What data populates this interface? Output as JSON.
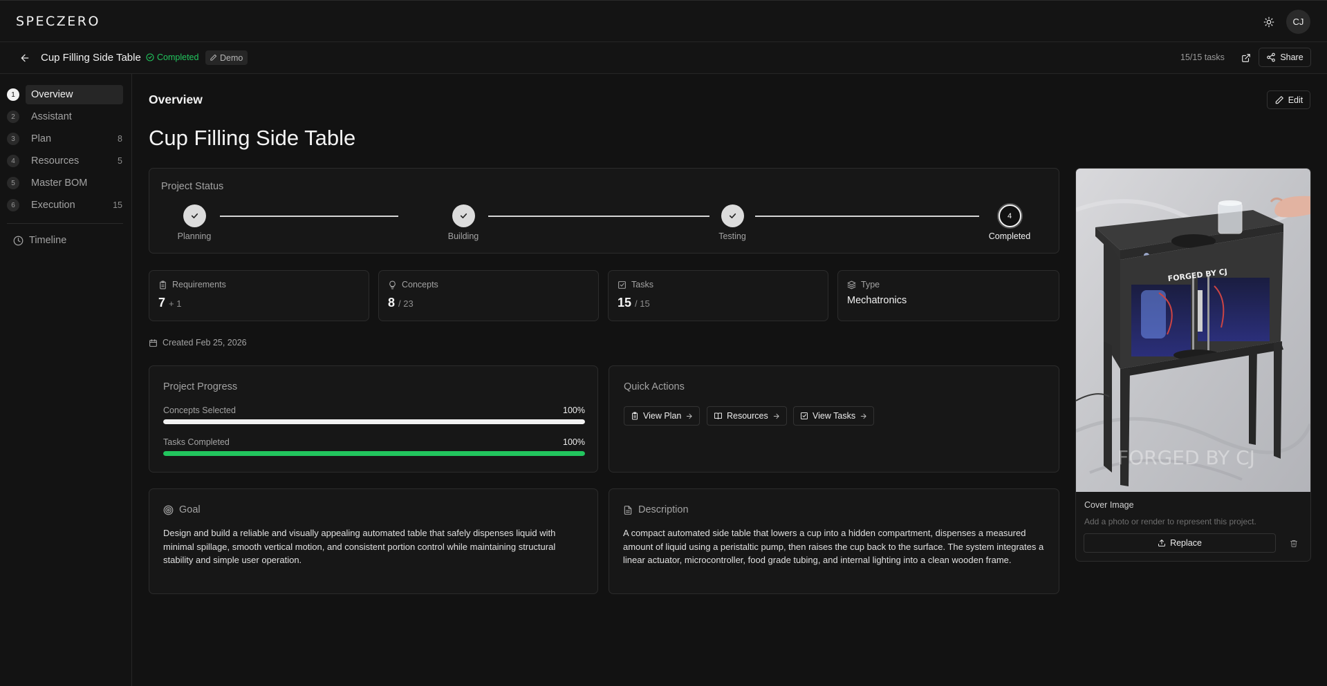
{
  "app": {
    "logo": "SPECZERO",
    "avatar_initials": "CJ"
  },
  "header": {
    "project_name": "Cup Filling Side Table",
    "status": "Completed",
    "badge": "Demo",
    "tasks_count": "15/15 tasks",
    "share_label": "Share"
  },
  "sidebar": {
    "items": [
      {
        "num": "1",
        "label": "Overview",
        "count": ""
      },
      {
        "num": "2",
        "label": "Assistant",
        "count": ""
      },
      {
        "num": "3",
        "label": "Plan",
        "count": "8"
      },
      {
        "num": "4",
        "label": "Resources",
        "count": "5"
      },
      {
        "num": "5",
        "label": "Master BOM",
        "count": ""
      },
      {
        "num": "6",
        "label": "Execution",
        "count": "15"
      }
    ],
    "timeline_label": "Timeline"
  },
  "main": {
    "section_title": "Overview",
    "edit_label": "Edit",
    "title": "Cup Filling Side Table",
    "project_status": {
      "label": "Project Status",
      "steps": [
        {
          "label": "Planning",
          "state": "done"
        },
        {
          "label": "Building",
          "state": "done"
        },
        {
          "label": "Testing",
          "state": "done"
        },
        {
          "label": "Completed",
          "state": "current",
          "num": "4"
        }
      ]
    },
    "stats": {
      "requirements": {
        "label": "Requirements",
        "value": "7",
        "sub": "+ 1"
      },
      "concepts": {
        "label": "Concepts",
        "value": "8",
        "sub": "/ 23"
      },
      "tasks": {
        "label": "Tasks",
        "value": "15",
        "sub": "/ 15"
      },
      "type": {
        "label": "Type",
        "value": "Mechatronics"
      }
    },
    "created": "Created Feb 25, 2026",
    "progress": {
      "label": "Project Progress",
      "rows": [
        {
          "label": "Concepts Selected",
          "pct": "100%",
          "fraction": 1.0,
          "color": "#f2f2f2"
        },
        {
          "label": "Tasks Completed",
          "pct": "100%",
          "fraction": 1.0,
          "color": "#22c55e"
        }
      ]
    },
    "quick_actions": {
      "label": "Quick Actions",
      "buttons": [
        "View Plan",
        "Resources",
        "View Tasks"
      ]
    },
    "goal": {
      "label": "Goal",
      "text": "Design and build a reliable and visually appealing automated table that safely dispenses liquid with minimal spillage, smooth vertical motion, and consistent portion control while maintaining structural stability and simple user operation."
    },
    "description": {
      "label": "Description",
      "text": "A compact automated side table that lowers a cup into a hidden compartment, dispenses a measured amount of liquid using a peristaltic pump, then raises the cup back to the surface. The system integrates a linear actuator, microcontroller, food grade tubing, and internal lighting into a clean wooden frame."
    },
    "cover": {
      "label": "Cover Image",
      "hint": "Add a photo or render to represent this project.",
      "replace_label": "Replace",
      "image_text": "FORGED BY CJ"
    }
  },
  "colors": {
    "accent_green": "#22c55e",
    "background": "#121212",
    "card": "#171717"
  }
}
